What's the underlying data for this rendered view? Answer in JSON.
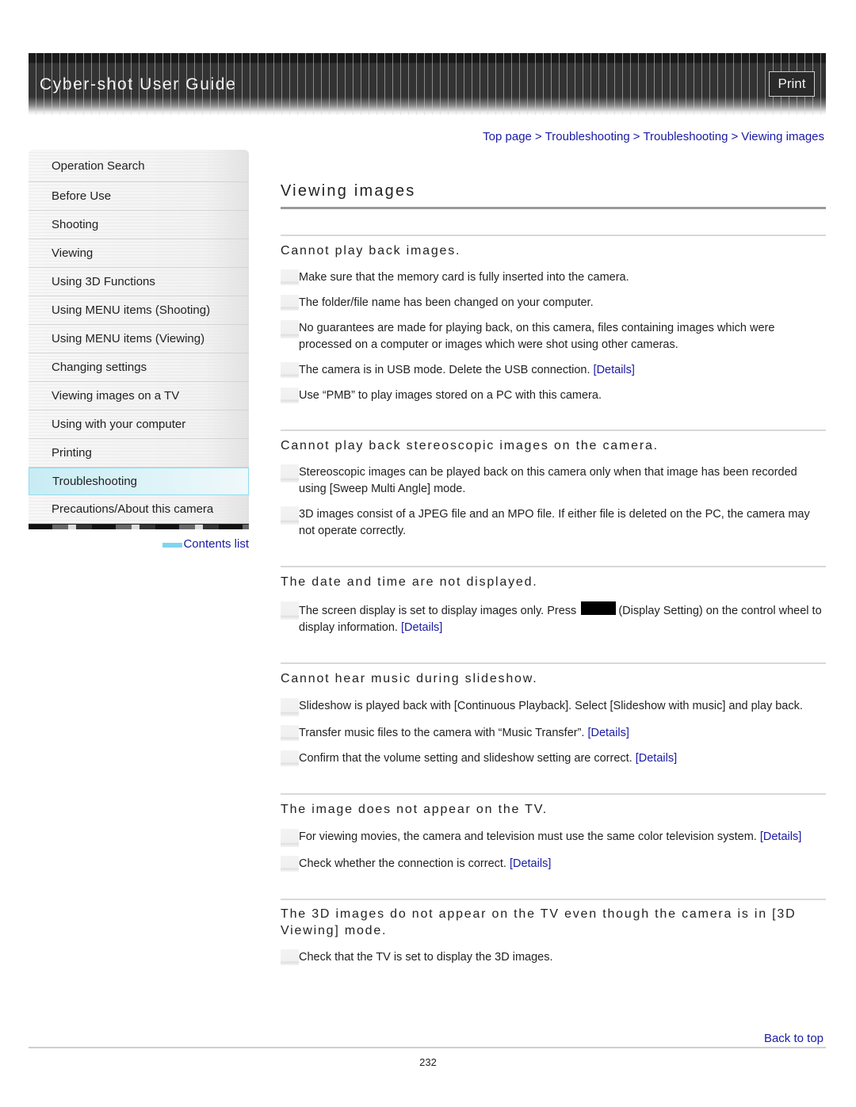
{
  "header": {
    "title": "Cyber-shot User Guide",
    "print_label": "Print"
  },
  "breadcrumb": {
    "items": [
      "Top page",
      "Troubleshooting",
      "Troubleshooting",
      "Viewing images"
    ],
    "separator": ">"
  },
  "sidebar": {
    "items": [
      {
        "label": "Operation Search"
      },
      {
        "label": "Before Use"
      },
      {
        "label": "Shooting"
      },
      {
        "label": "Viewing"
      },
      {
        "label": "Using 3D Functions"
      },
      {
        "label": "Using MENU items (Shooting)"
      },
      {
        "label": "Using MENU items (Viewing)"
      },
      {
        "label": "Changing settings"
      },
      {
        "label": "Viewing images on a TV"
      },
      {
        "label": "Using with your computer"
      },
      {
        "label": "Printing"
      },
      {
        "label": "Troubleshooting",
        "active": true
      },
      {
        "label": "Precautions/About this camera"
      }
    ],
    "contents_list_label": "Contents list",
    "contents_list_color": "#7fd4f0"
  },
  "main": {
    "title": "Viewing images",
    "details_label": "[Details]",
    "sections": [
      {
        "title": "Cannot play back images.",
        "items": [
          {
            "text": "Make sure that the memory card is fully inserted into the camera."
          },
          {
            "text": "The folder/file name has been changed on your computer."
          },
          {
            "text": "No guarantees are made for playing back, on this camera, files containing images which were processed on a computer or images which were shot using other cameras."
          },
          {
            "text": "The camera is in USB mode. Delete the USB connection. ",
            "has_details": true
          },
          {
            "text": "Use “PMB” to play images stored on a PC with this camera."
          }
        ]
      },
      {
        "title": "Cannot play back stereoscopic images on the camera.",
        "items": [
          {
            "text": "Stereoscopic images can be played back on this camera only when that image has been recorded using [Sweep Multi Angle] mode."
          },
          {
            "text": "3D images consist of a JPEG file and an MPO file. If either file is deleted on the PC, the camera may not operate correctly."
          }
        ]
      },
      {
        "title": "The date and time are not displayed.",
        "items": [
          {
            "text_before": "The screen display is set to display images only. Press ",
            "icon": "display-setting-key-icon",
            "text_after": "(Display Setting) on the control wheel to display information. ",
            "has_details": true
          }
        ]
      },
      {
        "title": "Cannot hear music during slideshow.",
        "items": [
          {
            "text": "Slideshow is played back with [Continuous Playback]. Select [Slideshow with music] and play back."
          },
          {
            "text": "Transfer music files to the camera with “Music Transfer”. ",
            "has_details": true
          },
          {
            "text": "Confirm that the volume setting and slideshow setting are correct. ",
            "has_details": true
          }
        ]
      },
      {
        "title": "The image does not appear on the TV.",
        "items": [
          {
            "text": "For viewing movies, the camera and television must use the same color television system. ",
            "has_details": true
          },
          {
            "text": "Check whether the connection is correct. ",
            "has_details": true
          }
        ]
      },
      {
        "title": "The 3D images do not appear on the TV even though the camera is in [3D Viewing] mode.",
        "items": [
          {
            "text": "Check that the TV is set to display the 3D images."
          }
        ]
      }
    ]
  },
  "footer": {
    "back_to_top_label": "Back to top",
    "page_number": "232"
  },
  "colors": {
    "link": "#1a1aa6",
    "active_nav": "#c8ecf4",
    "header_bg": "#333333"
  }
}
